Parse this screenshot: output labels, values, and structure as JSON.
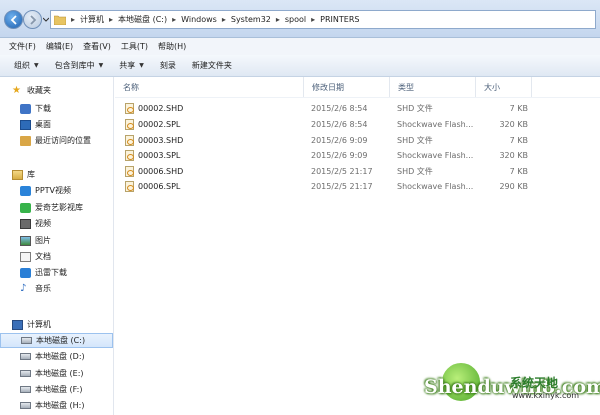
{
  "address": {
    "path": [
      "计算机",
      "本地磁盘 (C:)",
      "Windows",
      "System32",
      "spool",
      "PRINTERS"
    ]
  },
  "menu": [
    "文件(F)",
    "编辑(E)",
    "查看(V)",
    "工具(T)",
    "帮助(H)"
  ],
  "toolbar": {
    "organize": "组织",
    "include_library": "包含到库中",
    "share": "共享",
    "burn": "刻录",
    "new_folder": "新建文件夹"
  },
  "nav": {
    "favorites_title": "收藏夹",
    "favorites": [
      "下载",
      "桌面",
      "最近访问的位置"
    ],
    "libraries_title": "库",
    "libraries": [
      "PPTV视频",
      "爱奇艺影视库",
      "视频",
      "图片",
      "文档",
      "迅雷下载",
      "音乐"
    ],
    "computer_title": "计算机",
    "drives": [
      "本地磁盘 (C:)",
      "本地磁盘 (D:)",
      "本地磁盘 (E:)",
      "本地磁盘 (F:)",
      "本地磁盘 (H:)"
    ]
  },
  "columns": {
    "name": "名称",
    "date": "修改日期",
    "type": "类型",
    "size": "大小"
  },
  "files": [
    {
      "name": "00002.SHD",
      "date": "2015/2/6 8:54",
      "type": "SHD 文件",
      "size": "7 KB"
    },
    {
      "name": "00002.SPL",
      "date": "2015/2/6 8:54",
      "type": "Shockwave Flash...",
      "size": "320 KB"
    },
    {
      "name": "00003.SHD",
      "date": "2015/2/6 9:09",
      "type": "SHD 文件",
      "size": "7 KB"
    },
    {
      "name": "00003.SPL",
      "date": "2015/2/6 9:09",
      "type": "Shockwave Flash...",
      "size": "320 KB"
    },
    {
      "name": "00006.SHD",
      "date": "2015/2/5 21:17",
      "type": "SHD 文件",
      "size": "7 KB"
    },
    {
      "name": "00006.SPL",
      "date": "2015/2/5 21:17",
      "type": "Shockwave Flash...",
      "size": "290 KB"
    }
  ],
  "watermark": {
    "brand": "Shenduwin8.com",
    "site_name": "系统天地",
    "url": "www.kxinyk.com"
  },
  "colors": {
    "accent": "#3f74c6",
    "selection": "#d4e6fb",
    "watermark_green": "#4ea82a"
  }
}
